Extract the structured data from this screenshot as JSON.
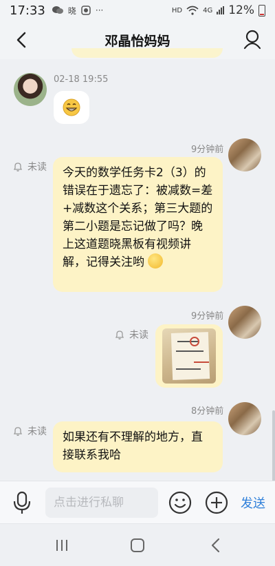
{
  "status_bar": {
    "time": "17:33",
    "left_icons": [
      "chat-icon",
      "晓",
      "camera-icon",
      "···"
    ],
    "hd": "HD",
    "network": "4G",
    "battery": "12%"
  },
  "header": {
    "title": "邓晶怡妈妈"
  },
  "messages": {
    "incoming": {
      "timestamp": "02-18 19:55",
      "content": "grinning-emoji"
    },
    "m1": {
      "time": "9分钟前",
      "status": "未读",
      "text": "今天的数学任务卡2（3）的错误在于遗忘了：被减数=差+减数这个关系；第三大题的第二小题是忘记做了吗？晚上这道题晓黑板有视频讲解，记得关注哟"
    },
    "m2": {
      "time": "9分钟前",
      "status": "未读",
      "content": "homework-photo"
    },
    "m3": {
      "time": "8分钟前",
      "status": "未读",
      "text": "如果还有不理解的地方，直接联系我哈"
    }
  },
  "input_bar": {
    "placeholder": "点击进行私聊",
    "send_label": "发送"
  },
  "colors": {
    "bubble": "#fdf3c6",
    "send": "#2e7fd9",
    "background": "#eef0f3"
  }
}
